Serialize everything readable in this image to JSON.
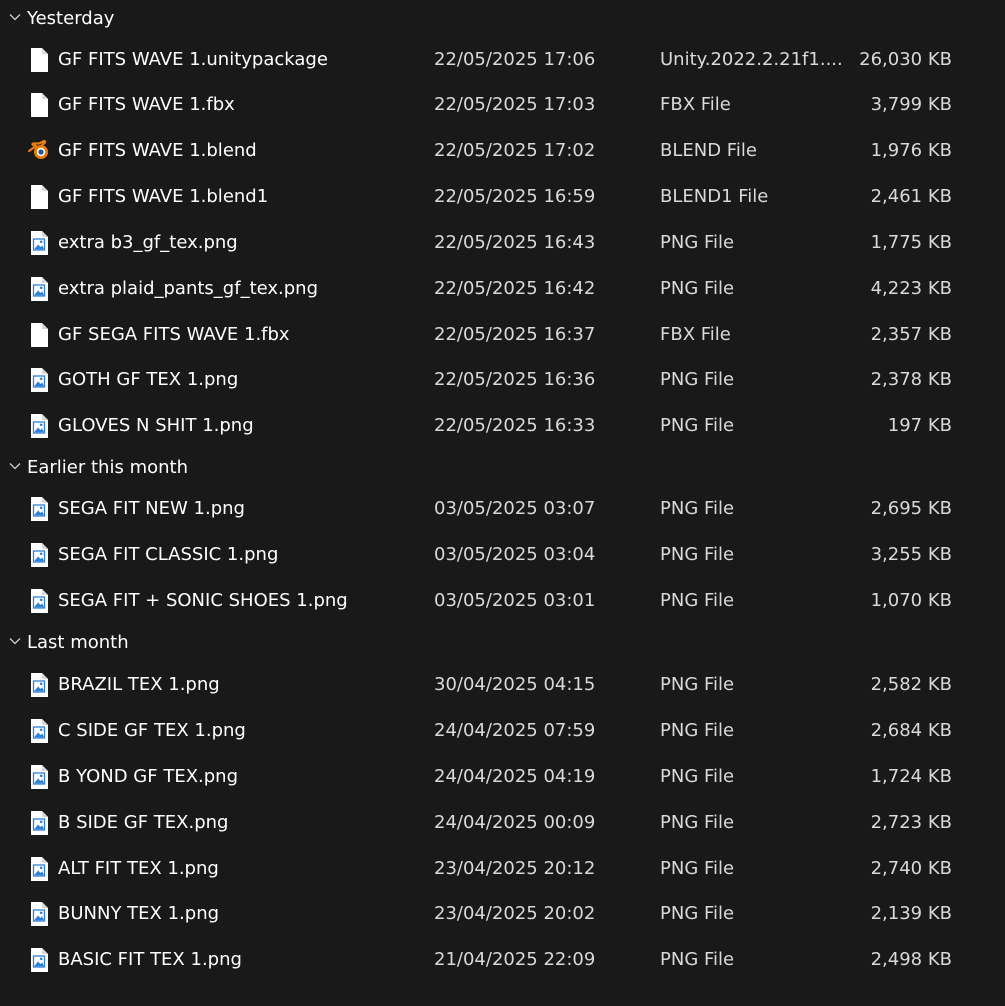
{
  "groups": [
    {
      "title": "Yesterday",
      "files": [
        {
          "name": "GF FITS WAVE 1.unitypackage",
          "date": "22/05/2025 17:06",
          "type": "Unity.2022.2.21f1....",
          "size": "26,030 KB",
          "icon": "blank-file-icon"
        },
        {
          "name": "GF FITS WAVE 1.fbx",
          "date": "22/05/2025 17:03",
          "type": "FBX File",
          "size": "3,799 KB",
          "icon": "blank-file-icon"
        },
        {
          "name": "GF FITS WAVE 1.blend",
          "date": "22/05/2025 17:02",
          "type": "BLEND File",
          "size": "1,976 KB",
          "icon": "blender-icon"
        },
        {
          "name": "GF FITS WAVE 1.blend1",
          "date": "22/05/2025 16:59",
          "type": "BLEND1 File",
          "size": "2,461 KB",
          "icon": "blank-file-icon"
        },
        {
          "name": "extra b3_gf_tex.png",
          "date": "22/05/2025 16:43",
          "type": "PNG File",
          "size": "1,775 KB",
          "icon": "image-file-icon"
        },
        {
          "name": "extra plaid_pants_gf_tex.png",
          "date": "22/05/2025 16:42",
          "type": "PNG File",
          "size": "4,223 KB",
          "icon": "image-file-icon"
        },
        {
          "name": "GF SEGA FITS WAVE 1.fbx",
          "date": "22/05/2025 16:37",
          "type": "FBX File",
          "size": "2,357 KB",
          "icon": "blank-file-icon"
        },
        {
          "name": "GOTH GF TEX 1.png",
          "date": "22/05/2025 16:36",
          "type": "PNG File",
          "size": "2,378 KB",
          "icon": "image-file-icon"
        },
        {
          "name": "GLOVES N SHIT 1.png",
          "date": "22/05/2025 16:33",
          "type": "PNG File",
          "size": "197 KB",
          "icon": "image-file-icon"
        }
      ]
    },
    {
      "title": "Earlier this month",
      "files": [
        {
          "name": "SEGA FIT NEW 1.png",
          "date": "03/05/2025 03:07",
          "type": "PNG File",
          "size": "2,695 KB",
          "icon": "image-file-icon"
        },
        {
          "name": "SEGA FIT CLASSIC 1.png",
          "date": "03/05/2025 03:04",
          "type": "PNG File",
          "size": "3,255 KB",
          "icon": "image-file-icon"
        },
        {
          "name": "SEGA FIT + SONIC SHOES 1.png",
          "date": "03/05/2025 03:01",
          "type": "PNG File",
          "size": "1,070 KB",
          "icon": "image-file-icon"
        }
      ]
    },
    {
      "title": "Last month",
      "files": [
        {
          "name": "BRAZIL TEX 1.png",
          "date": "30/04/2025 04:15",
          "type": "PNG File",
          "size": "2,582 KB",
          "icon": "image-file-icon"
        },
        {
          "name": "C SIDE GF TEX 1.png",
          "date": "24/04/2025 07:59",
          "type": "PNG File",
          "size": "2,684 KB",
          "icon": "image-file-icon"
        },
        {
          "name": "B YOND GF TEX.png",
          "date": "24/04/2025 04:19",
          "type": "PNG File",
          "size": "1,724 KB",
          "icon": "image-file-icon"
        },
        {
          "name": "B SIDE GF TEX.png",
          "date": "24/04/2025 00:09",
          "type": "PNG File",
          "size": "2,723 KB",
          "icon": "image-file-icon"
        },
        {
          "name": "ALT FIT TEX 1.png",
          "date": "23/04/2025 20:12",
          "type": "PNG File",
          "size": "2,740 KB",
          "icon": "image-file-icon"
        },
        {
          "name": "BUNNY TEX 1.png",
          "date": "23/04/2025 20:02",
          "type": "PNG File",
          "size": "2,139 KB",
          "icon": "image-file-icon"
        },
        {
          "name": "BASIC FIT TEX 1.png",
          "date": "21/04/2025 22:09",
          "type": "PNG File",
          "size": "2,498 KB",
          "icon": "image-file-icon"
        }
      ]
    }
  ],
  "colors": {
    "background": "#191919",
    "text": "#ffffff",
    "secondary_text": "#d9d9d9",
    "image_icon_accent": "#2f7fd6",
    "blender_orange": "#e87d0d",
    "blender_blue": "#265787"
  }
}
